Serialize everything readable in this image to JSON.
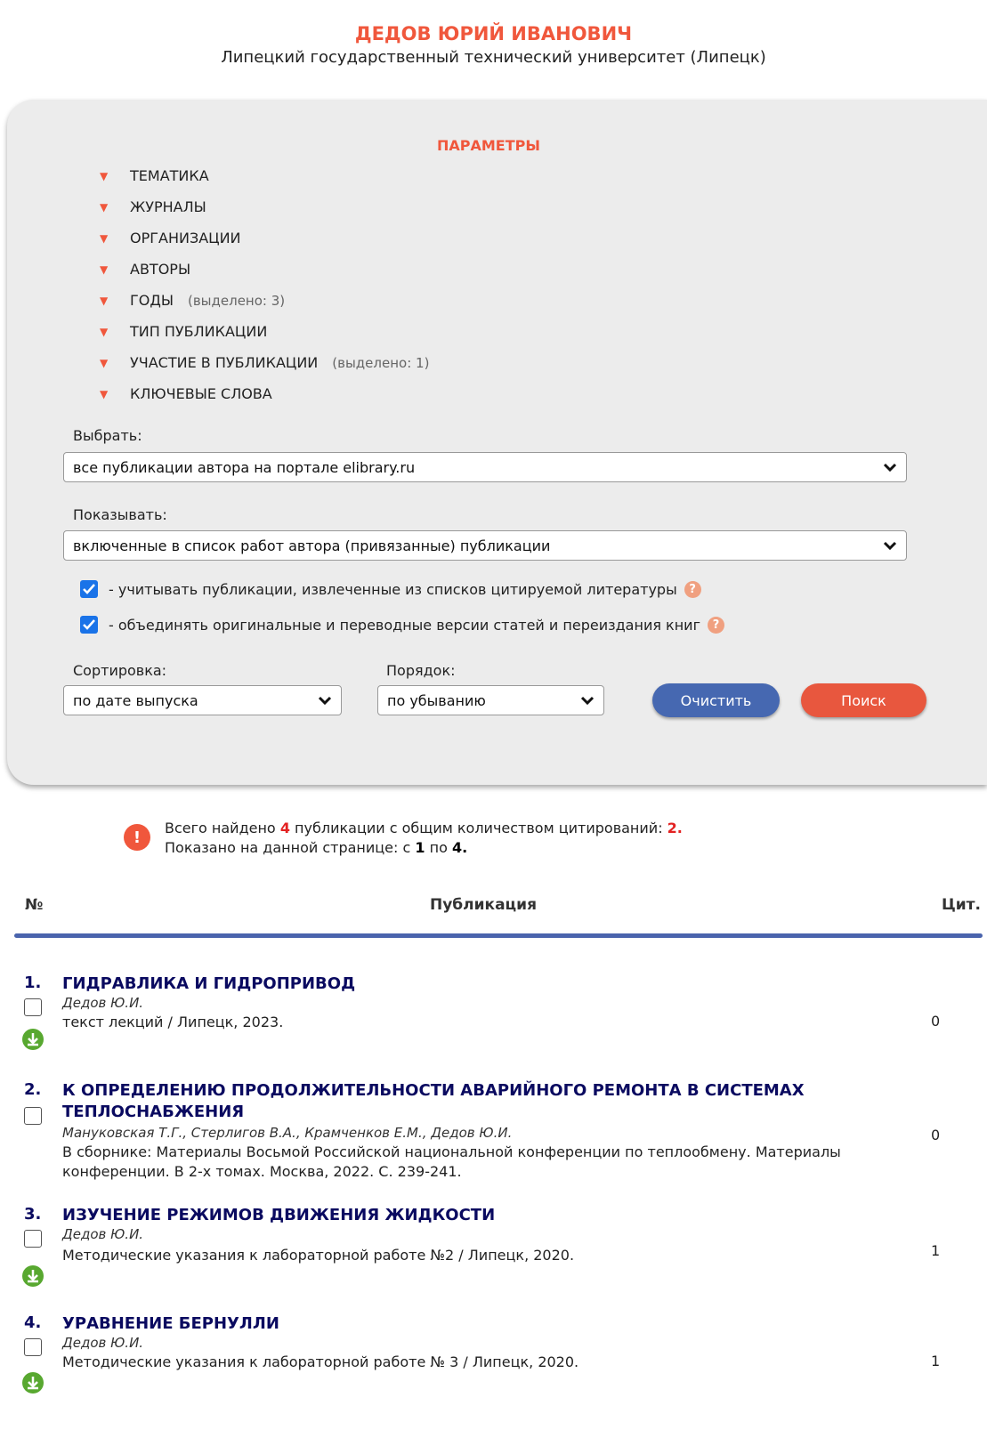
{
  "author": {
    "name": "ДЕДОВ ЮРИЙ ИВАНОВИЧ",
    "org": "Липецкий государственный технический университет (Липецк)"
  },
  "params": {
    "title": "ПАРАМЕТРЫ",
    "items": [
      {
        "label": "ТЕМАТИКА",
        "note": ""
      },
      {
        "label": "ЖУРНАЛЫ",
        "note": ""
      },
      {
        "label": "ОРГАНИЗАЦИИ",
        "note": ""
      },
      {
        "label": "АВТОРЫ",
        "note": ""
      },
      {
        "label": "ГОДЫ",
        "note": "(выделено: 3)"
      },
      {
        "label": "ТИП ПУБЛИКАЦИИ",
        "note": ""
      },
      {
        "label": "УЧАСТИЕ В ПУБЛИКАЦИИ",
        "note": "(выделено: 1)"
      },
      {
        "label": "КЛЮЧЕВЫЕ СЛОВА",
        "note": ""
      }
    ],
    "select_label": "Выбрать:",
    "select_value": "все публикации автора на портале elibrary.ru",
    "show_label": "Показывать:",
    "show_value": "включенные в список работ автора (привязанные) публикации",
    "check1": "- учитывать публикации, извлеченные из списков цитируемой литературы",
    "check2": "- объединять оригинальные и переводные версии статей и переиздания книг",
    "sort_label": "Сортировка:",
    "sort_value": "по дате выпуска",
    "order_label": "Порядок:",
    "order_value": "по убыванию",
    "clear_label": "Очистить",
    "search_label": "Поиск"
  },
  "summary": {
    "line1_a": "Всего найдено",
    "count": "4",
    "line1_b": "публикации с общим количеством цитирований:",
    "citations": "2.",
    "line2_a": "Показано на данной странице: с",
    "from": "1",
    "line2_b": "по",
    "to": "4."
  },
  "table": {
    "col_num": "№",
    "col_pub": "Публикация",
    "col_cit": "Цит."
  },
  "publications": [
    {
      "num": "1.",
      "title": "ГИДРАВЛИКА И ГИДРОПРИВОД",
      "authors": "Дедов Ю.И.",
      "source": "текст лекций / Липецк, 2023.",
      "cit": "0"
    },
    {
      "num": "2.",
      "title": "К ОПРЕДЕЛЕНИЮ ПРОДОЛЖИТЕЛЬНОСТИ АВАРИЙНОГО РЕМОНТА В СИСТЕМАХ ТЕПЛОСНАБЖЕНИЯ",
      "authors": "Мануковская Т.Г., Стерлигов В.А., Крамченков Е.М., Дедов Ю.И.",
      "source": "В сборнике: Материалы Восьмой Российской национальной конференции по теплообмену. Материалы конференции. В 2-х томах. Москва, 2022. С. 239-241.",
      "cit": "0"
    },
    {
      "num": "3.",
      "title": "ИЗУЧЕНИЕ РЕЖИМОВ ДВИЖЕНИЯ ЖИДКОСТИ",
      "authors": "Дедов Ю.И.",
      "source": "Методические указания к лабораторной работе №2 / Липецк, 2020.",
      "cit": "1"
    },
    {
      "num": "4.",
      "title": "УРАВНЕНИЕ БЕРНУЛЛИ",
      "authors": "Дедов Ю.И.",
      "source": "Методические указания к лабораторной работе № 3 / Липецк, 2020.",
      "cit": "1"
    }
  ]
}
